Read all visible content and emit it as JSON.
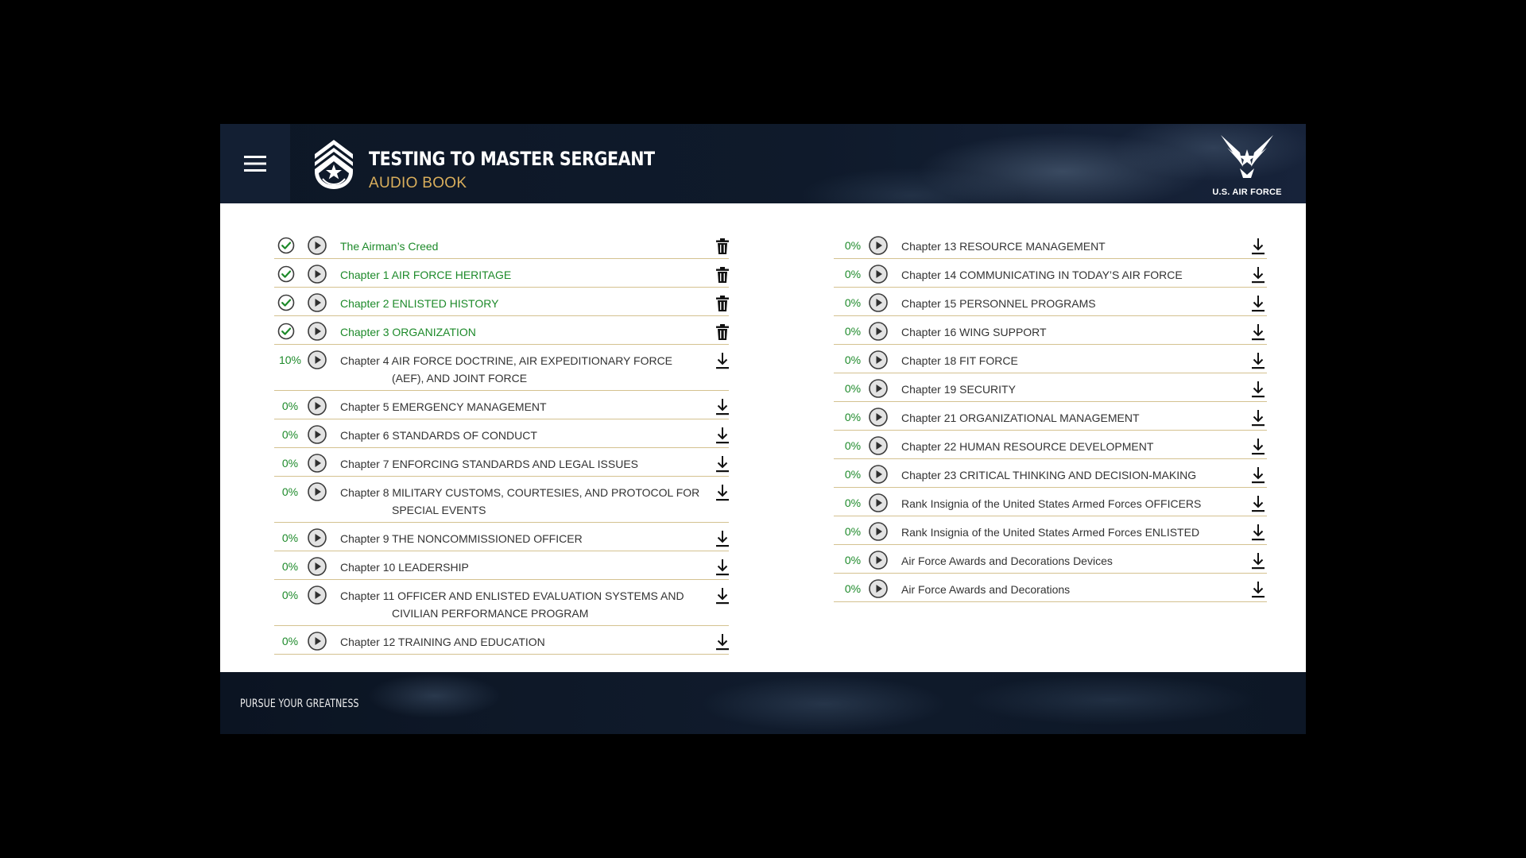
{
  "header": {
    "title": "TESTING TO MASTER SERGEANT",
    "subtitle": "AUDIO BOOK",
    "logo_text": "U.S. AIR FORCE",
    "menu_icon": "hamburger-menu-icon",
    "emblem_icon": "master-sergeant-rank-insignia-icon"
  },
  "colors": {
    "complete_green": "#1d8a2a",
    "subtitle_gold": "#d9ae5c",
    "divider": "#d4c290"
  },
  "chapters_left": [
    {
      "status": "complete",
      "title": "The Airman’s Creed",
      "action": "delete"
    },
    {
      "status": "complete",
      "title": "Chapter 1 AIR FORCE HERITAGE",
      "action": "delete"
    },
    {
      "status": "complete",
      "title": "Chapter 2 ENLISTED HISTORY",
      "action": "delete"
    },
    {
      "status": "complete",
      "title": "Chapter 3 ORGANIZATION",
      "action": "delete"
    },
    {
      "status": "10%",
      "title": "Chapter 4 AIR FORCE DOCTRINE, AIR EXPEDITIONARY FORCE",
      "title2": "(AEF), AND JOINT FORCE",
      "action": "download"
    },
    {
      "status": "0%",
      "title": "Chapter 5 EMERGENCY MANAGEMENT",
      "action": "download"
    },
    {
      "status": "0%",
      "title": "Chapter 6 STANDARDS OF CONDUCT",
      "action": "download"
    },
    {
      "status": "0%",
      "title": "Chapter 7 ENFORCING STANDARDS AND LEGAL ISSUES",
      "action": "download"
    },
    {
      "status": "0%",
      "title": "Chapter 8 MILITARY CUSTOMS, COURTESIES, AND PROTOCOL FOR",
      "title2": "SPECIAL EVENTS",
      "action": "download"
    },
    {
      "status": "0%",
      "title": "Chapter 9 THE NONCOMMISSIONED OFFICER",
      "action": "download"
    },
    {
      "status": "0%",
      "title": "Chapter 10 LEADERSHIP",
      "action": "download"
    },
    {
      "status": "0%",
      "title": "Chapter 11 OFFICER AND ENLISTED EVALUATION SYSTEMS AND",
      "title2": "CIVILIAN PERFORMANCE PROGRAM",
      "action": "download"
    },
    {
      "status": "0%",
      "title": "Chapter 12 TRAINING AND EDUCATION",
      "action": "download"
    }
  ],
  "chapters_right": [
    {
      "status": "0%",
      "title": "Chapter 13 RESOURCE MANAGEMENT",
      "action": "download"
    },
    {
      "status": "0%",
      "title": "Chapter 14 COMMUNICATING IN TODAY’S AIR FORCE",
      "action": "download"
    },
    {
      "status": "0%",
      "title": "Chapter 15 PERSONNEL PROGRAMS",
      "action": "download"
    },
    {
      "status": "0%",
      "title": "Chapter 16 WING SUPPORT",
      "action": "download"
    },
    {
      "status": "0%",
      "title": "Chapter 18 FIT FORCE",
      "action": "download"
    },
    {
      "status": "0%",
      "title": "Chapter 19 SECURITY",
      "action": "download"
    },
    {
      "status": "0%",
      "title": "Chapter 21 ORGANIZATIONAL MANAGEMENT",
      "action": "download"
    },
    {
      "status": "0%",
      "title": "Chapter 22 HUMAN RESOURCE DEVELOPMENT",
      "action": "download"
    },
    {
      "status": "0%",
      "title": "Chapter 23 CRITICAL THINKING AND DECISION-MAKING",
      "action": "download"
    },
    {
      "status": "0%",
      "title": "Rank Insignia of the United States Armed Forces OFFICERS",
      "action": "download"
    },
    {
      "status": "0%",
      "title": "Rank Insignia of the United States Armed Forces ENLISTED",
      "action": "download"
    },
    {
      "status": "0%",
      "title": "Air Force Awards and Decorations Devices",
      "action": "download"
    },
    {
      "status": "0%",
      "title": "Air Force Awards and Decorations",
      "action": "download"
    }
  ],
  "footer": {
    "tagline": "PURSUE YOUR GREATNESS"
  }
}
